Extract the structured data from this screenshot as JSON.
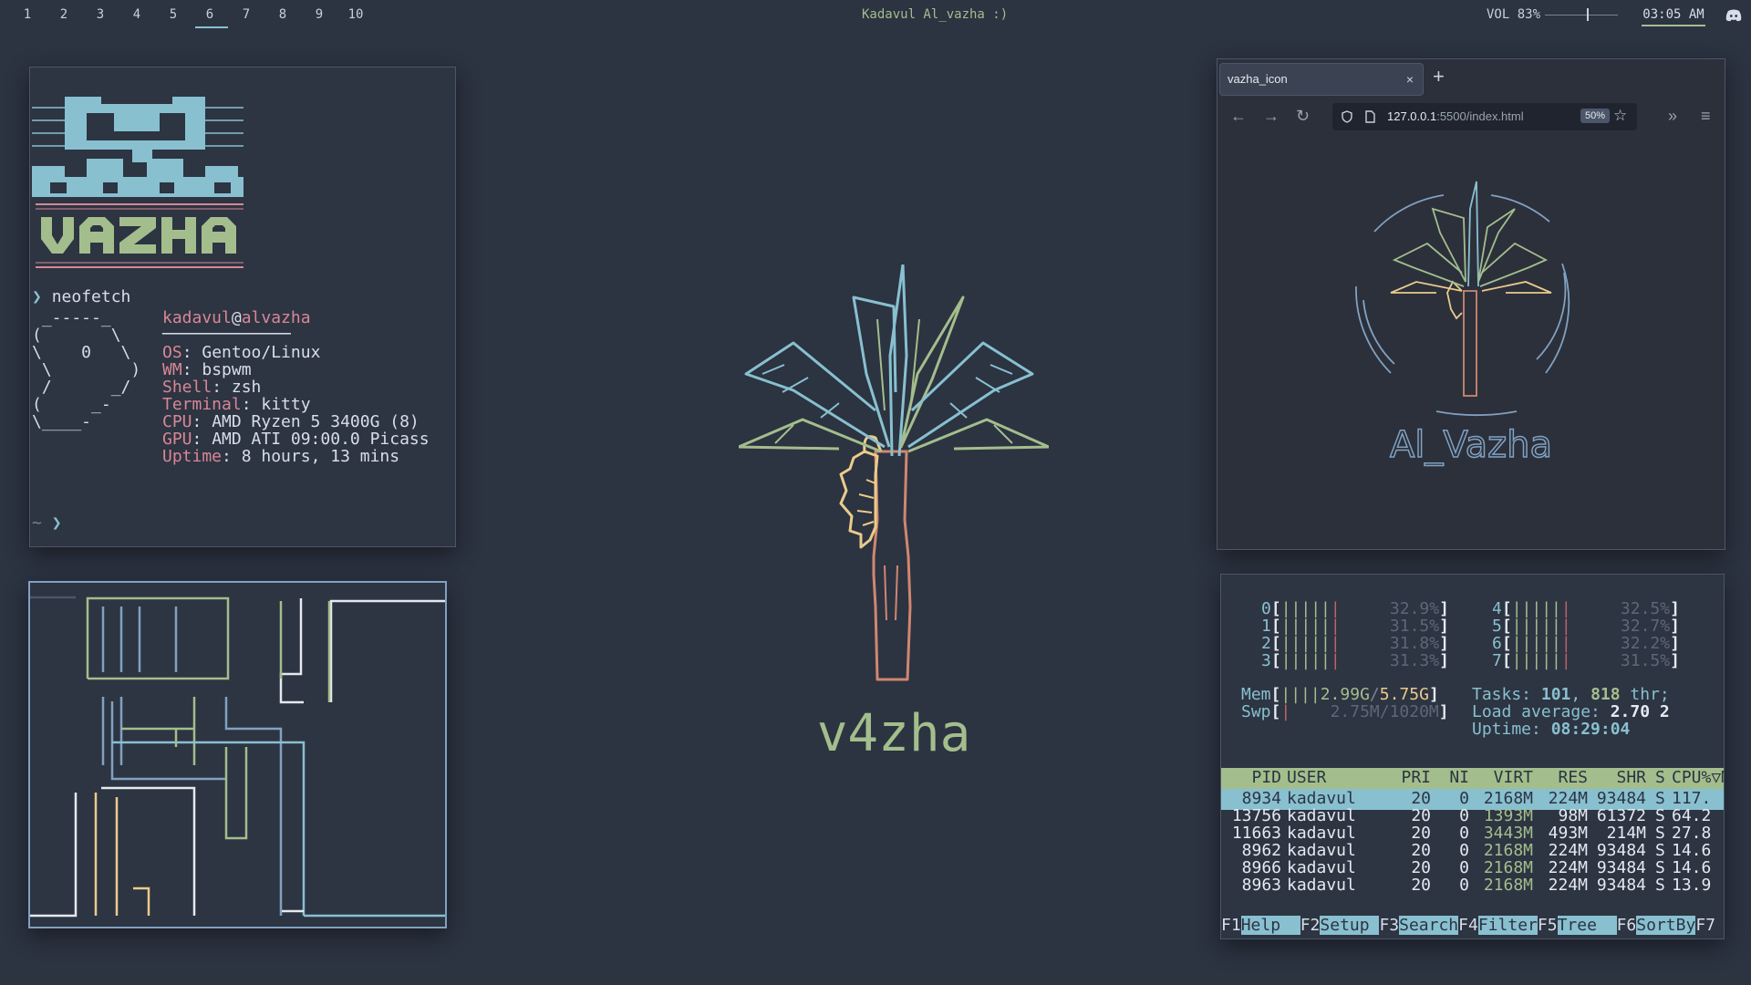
{
  "bar": {
    "workspaces": [
      "1",
      "2",
      "3",
      "4",
      "5",
      "6",
      "7",
      "8",
      "9",
      "10"
    ],
    "active_workspace": "6",
    "title": "Kadavul Al_vazha :)",
    "volume_label": "VOL 83%",
    "volume_level": 0.83,
    "clock": "03:05 AM",
    "tray_icon": "discord-icon"
  },
  "neofetch": {
    "ascii_art_text": "VAZHA",
    "prompt_symbol": "❯",
    "command": "neofetch",
    "user": "kadavul",
    "at": "@",
    "host": "alvazha",
    "separator": "─────────────",
    "info": [
      {
        "key": "OS",
        "value": ": Gentoo/Linux"
      },
      {
        "key": "WM",
        "value": ": bspwm"
      },
      {
        "key": "Shell",
        "value": ": zsh"
      },
      {
        "key": "Terminal",
        "value": ": kitty"
      },
      {
        "key": "CPU",
        "value": ": AMD Ryzen 5 3400G (8)"
      },
      {
        "key": "GPU",
        "value": ": AMD ATI 09:00.0 Picass"
      },
      {
        "key": "Uptime",
        "value": ": 8 hours, 13 mins"
      }
    ],
    "distro_logo": [
      " _-----_",
      "(       \\",
      "\\    0   \\",
      " \\        )",
      " /      _/",
      "(     _-",
      "\\____-"
    ],
    "final_prompt_dir": "~",
    "final_prompt_symbol": "❯"
  },
  "center": {
    "label": "v4zha"
  },
  "browser": {
    "tab_title": "vazha_icon",
    "tab_close": "×",
    "new_tab": "+",
    "url_host": "127.0.0.1",
    "url_rest": ":5500/index.html",
    "zoom": "50%",
    "site_title": "Al_Vazha"
  },
  "htop": {
    "cpus_left": [
      {
        "id": "0",
        "pct": "32.9%"
      },
      {
        "id": "1",
        "pct": "31.5%"
      },
      {
        "id": "2",
        "pct": "31.8%"
      },
      {
        "id": "3",
        "pct": "31.3%"
      }
    ],
    "cpus_right": [
      {
        "id": "4",
        "pct": "32.5%"
      },
      {
        "id": "5",
        "pct": "32.7%"
      },
      {
        "id": "6",
        "pct": "32.2%"
      },
      {
        "id": "7",
        "pct": "31.5%"
      }
    ],
    "cpu_bars": "|||||",
    "cpu_bar_red": "|",
    "mem_label": "Mem",
    "mem_bars": "||||",
    "mem_used": "2.99G",
    "mem_total": "5.75G",
    "swp_label": "Swp",
    "swp_value": "2.75M/1020M",
    "tasks_label": "Tasks: ",
    "tasks_count": "101",
    "tasks_sep": ", ",
    "threads": "818",
    "threads_label": " thr;",
    "load_label": "Load average: ",
    "load_values": "2.70 2",
    "uptime_label": "Uptime: ",
    "uptime_value": "08:29:04",
    "header": {
      "pid": "PID",
      "user": "USER",
      "pri": "PRI",
      "ni": "NI",
      "virt": "VIRT",
      "res": "RES",
      "shr": "SHR",
      "s": "S",
      "cpu": "CPU%▽M"
    },
    "processes": [
      {
        "pid": "8934",
        "user": "kadavul",
        "pri": "20",
        "ni": "0",
        "virt": "2168M",
        "res": "224M",
        "shr": "93484",
        "s": "S",
        "cpu": "117."
      },
      {
        "pid": "13756",
        "user": "kadavul",
        "pri": "20",
        "ni": "0",
        "virt": "1393M",
        "res": "98M",
        "shr": "61372",
        "s": "S",
        "cpu": "64.2"
      },
      {
        "pid": "11663",
        "user": "kadavul",
        "pri": "20",
        "ni": "0",
        "virt": "3443M",
        "res": "493M",
        "shr": "214M",
        "s": "S",
        "cpu": "27.8"
      },
      {
        "pid": "8962",
        "user": "kadavul",
        "pri": "20",
        "ni": "0",
        "virt": "2168M",
        "res": "224M",
        "shr": "93484",
        "s": "S",
        "cpu": "14.6"
      },
      {
        "pid": "8966",
        "user": "kadavul",
        "pri": "20",
        "ni": "0",
        "virt": "2168M",
        "res": "224M",
        "shr": "93484",
        "s": "S",
        "cpu": "14.6"
      },
      {
        "pid": "8963",
        "user": "kadavul",
        "pri": "20",
        "ni": "0",
        "virt": "2168M",
        "res": "224M",
        "shr": "93484",
        "s": "S",
        "cpu": "13.9"
      }
    ],
    "fkeys": [
      {
        "key": "F1",
        "label": "Help  "
      },
      {
        "key": "F2",
        "label": "Setup "
      },
      {
        "key": "F3",
        "label": "Search"
      },
      {
        "key": "F4",
        "label": "Filter"
      },
      {
        "key": "F5",
        "label": "Tree  "
      },
      {
        "key": "F6",
        "label": "SortBy"
      },
      {
        "key": "F7",
        "label": ""
      }
    ]
  },
  "colors": {
    "background": "#2c3341",
    "accent_green": "#a3be8c",
    "accent_blue": "#88c0d0",
    "accent_pink": "#d88796",
    "accent_yellow": "#ebcb8b",
    "accent_orange": "#d08770"
  }
}
